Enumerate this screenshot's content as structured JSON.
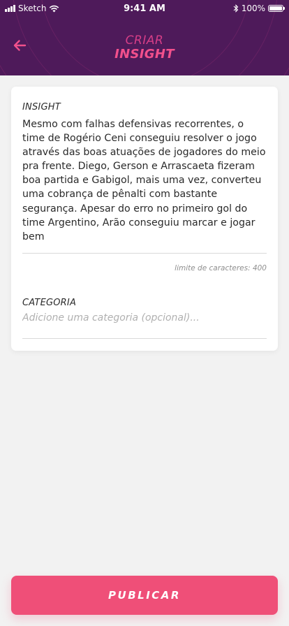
{
  "status_bar": {
    "carrier": "Sketch",
    "time": "9:41 AM",
    "battery_percent": "100%",
    "battery_level": 1.0
  },
  "header": {
    "back_icon": "arrow-left-icon",
    "title_top": "CRIAR",
    "title_main": "INSIGHT"
  },
  "form": {
    "insight_label": "INSIGHT",
    "insight_text": "Mesmo com falhas defensivas recorrentes, o time de Rogério Ceni conseguiu resolver o jogo através das boas atuações de jogadores do meio pra frente. Diego, Gerson e Arrascaeta fizeram boa partida e Gabigol, mais uma vez, converteu uma cobrança de pênalti com bastante segurança. Apesar do erro no primeiro gol do time Argentino, Arão conseguiu marcar e jogar bem",
    "char_limit": "limite de caracteres: 400",
    "category_label": "CATEGORIA",
    "category_value": "",
    "category_placeholder": "Adicione uma categoria (opcional)..."
  },
  "actions": {
    "publish_label": "PUBLICAR"
  },
  "colors": {
    "header_bg": "#4e1a5a",
    "accent": "#f2508c",
    "button": "#ef4f78",
    "background": "#f2f2f2"
  }
}
